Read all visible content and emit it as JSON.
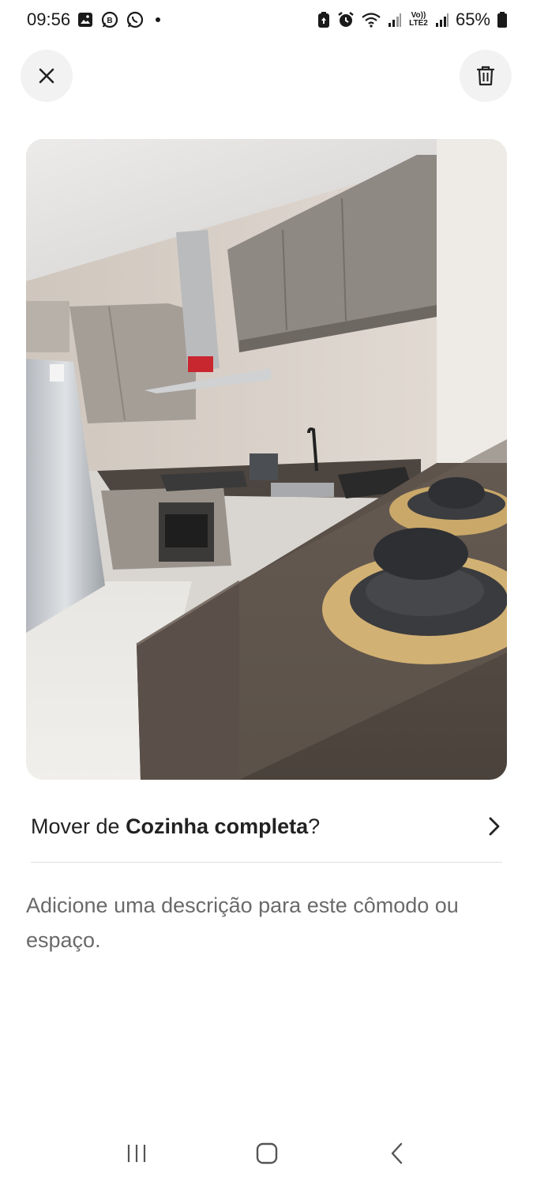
{
  "status_bar": {
    "time": "09:56",
    "battery": "65%",
    "left_icons": [
      "gallery-icon",
      "whatsapp-business-icon",
      "whatsapp-icon",
      "notification-dot"
    ],
    "right_icons": [
      "battery-saver-icon",
      "alarm-icon",
      "wifi-icon",
      "signal-icon",
      "volte-lte2-icon",
      "signal-icon",
      "battery-icon"
    ],
    "volte_label": "Vo)) LTE2"
  },
  "header": {
    "close_icon": "close-icon",
    "delete_icon": "trash-icon"
  },
  "photo": {
    "subject": "kitchen"
  },
  "move": {
    "prefix": "Mover de ",
    "room": "Cozinha completa",
    "suffix": "?",
    "chevron_icon": "chevron-right-icon"
  },
  "description": {
    "placeholder": "Adicione uma descrição para este cômodo ou espaço."
  },
  "nav": {
    "icons": [
      "recent-apps-icon",
      "home-icon",
      "back-icon"
    ]
  },
  "colors": {
    "button_bg": "#f2f2f2",
    "text_primary": "#222222",
    "text_secondary": "#6a6a6a",
    "divider": "#dddddd"
  }
}
